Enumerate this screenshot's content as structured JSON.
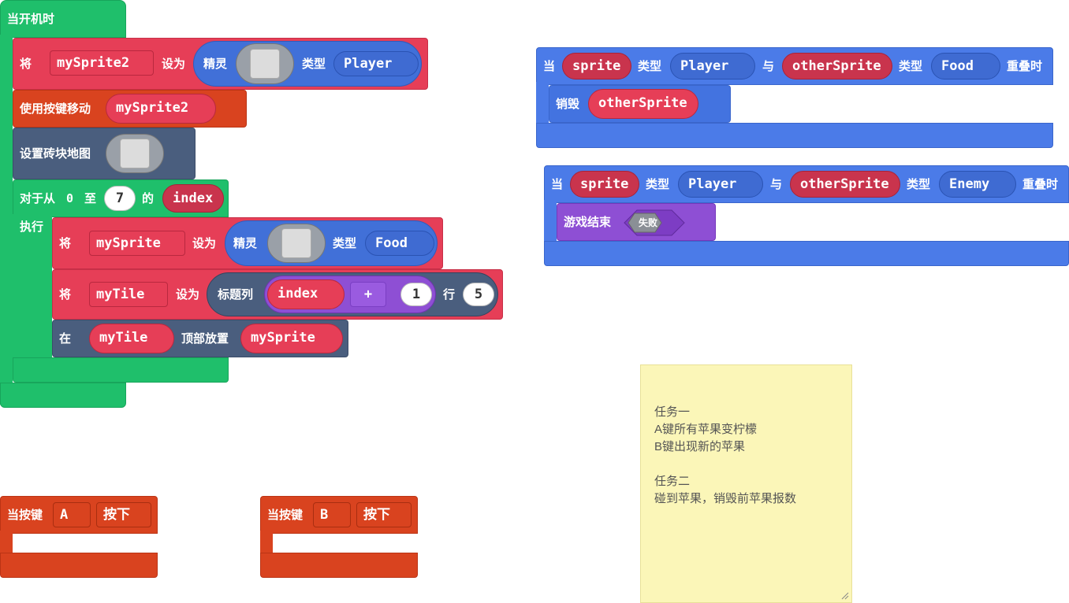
{
  "on_start": {
    "hat_label": "当开机时",
    "set_sprite": {
      "keyword": "将",
      "variable": "mySprite2",
      "op": "设为",
      "sprite_label": "精灵",
      "type_label": "类型",
      "kind": "Player"
    },
    "move_buttons": {
      "label": "使用按键移动",
      "variable": "mySprite2"
    },
    "set_tilemap": {
      "label": "设置砖块地图"
    },
    "for_loop": {
      "label": "对于从",
      "from": "0",
      "to_label": "至",
      "to": "7",
      "of_label": "的",
      "variable": "index",
      "do_label": "执行"
    },
    "inner_set_sprite": {
      "keyword": "将",
      "variable": "mySprite",
      "op": "设为",
      "sprite_label": "精灵",
      "type_label": "类型",
      "kind": "Food"
    },
    "set_tile": {
      "keyword": "将",
      "variable": "myTile",
      "op": "设为",
      "col_label": "标题列",
      "col_var": "index",
      "plus": "+",
      "plus_val": "1",
      "row_label": "行",
      "row_val": "5"
    },
    "place_on_top": {
      "keyword": "在",
      "tile_var": "myTile",
      "action": "顶部放置",
      "sprite_var": "mySprite"
    }
  },
  "overlap_food": {
    "when": "当",
    "sprite_var": "sprite",
    "type_label": "类型",
    "kind_a": "Player",
    "and_label": "与",
    "other_var": "otherSprite",
    "type_label2": "类型",
    "kind_b": "Food",
    "overlap_label": "重叠时",
    "destroy": {
      "label": "销毁",
      "variable": "otherSprite"
    }
  },
  "overlap_enemy": {
    "when": "当",
    "sprite_var": "sprite",
    "type_label": "类型",
    "kind_a": "Player",
    "and_label": "与",
    "other_var": "otherSprite",
    "type_label2": "类型",
    "kind_b": "Enemy",
    "overlap_label": "重叠时",
    "game_over": {
      "label": "游戏结束",
      "result": "失败"
    }
  },
  "button_a": {
    "label": "当按键",
    "key": "A",
    "state": "按下"
  },
  "button_b": {
    "label": "当按键",
    "key": "B",
    "state": "按下"
  },
  "note": {
    "lines": [
      "任务一",
      "A键所有苹果变柠檬",
      "B键出现新的苹果",
      "",
      "任务二",
      "碰到苹果，销毁前苹果报数"
    ]
  },
  "colors": {
    "loops": "#1fbf6b",
    "sprites": "#e63e57",
    "controller": "#d9431f",
    "scene": "#4a5e7e",
    "events": "#4b7be8",
    "game": "#8e4fd4",
    "note_bg": "#fbf6b8"
  },
  "icons": {
    "image_slot": "image-picker-icon",
    "resize": "resize-grip-icon"
  }
}
